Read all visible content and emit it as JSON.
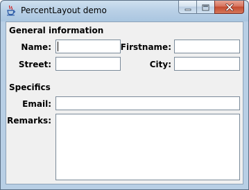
{
  "window": {
    "title": "PercentLayout demo",
    "icon": "java-cup-icon",
    "buttons": {
      "minimize_icon": "minimize-icon",
      "maximize_icon": "maximize-icon",
      "close_icon": "close-icon"
    }
  },
  "form": {
    "general_section": "General information",
    "name_label": "Name:",
    "name_value": "",
    "firstname_label": "Firstname:",
    "firstname_value": "",
    "street_label": "Street:",
    "street_value": "",
    "city_label": "City:",
    "city_value": "",
    "specifics_section": "Specifics",
    "email_label": "Email:",
    "email_value": "",
    "remarks_label": "Remarks:",
    "remarks_value": ""
  },
  "colors": {
    "title_gradient_top": "#cfe0ef",
    "panel_background": "#f0f0f0",
    "close_button": "#c44a2f"
  }
}
